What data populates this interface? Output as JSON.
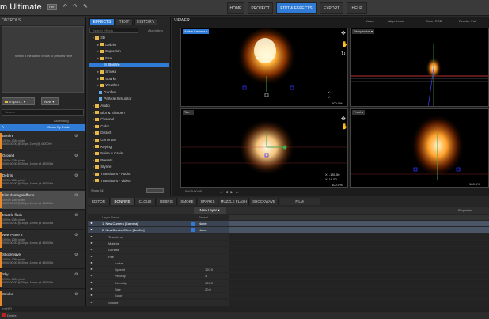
{
  "app": {
    "title": "m Ultimate",
    "file_menu": "File"
  },
  "nav": {
    "items": [
      {
        "label": "HOME"
      },
      {
        "label": "PROJECT"
      },
      {
        "label": "EDIT & EFFECTS"
      },
      {
        "label": "EXPORT"
      },
      {
        "label": "HELP"
      }
    ],
    "active_index": 2
  },
  "controls_panel": {
    "title": "ONTROLS",
    "preview_message": "Select a media file below to preview here"
  },
  "media": {
    "import_label": "Import...",
    "new_label": "New",
    "search_placeholder": "Search",
    "group_label": "A",
    "group_sort": "Group By Folder",
    "sort_label": "Ascending",
    "items": [
      {
        "name": "Bonfire",
        "line1": "1920 x 1080 pixels",
        "line2": "00:00:00:00 @ 30fps, 24ms(@ 48000Hz"
      },
      {
        "name": "Ground",
        "line1": "1920 x 1080 pixels",
        "line2": "00:00:00:00 @ 30fps, Jomes @ 48000Hz"
      },
      {
        "name": "Debris",
        "line1": "1920 x 1080 pixels",
        "line2": "00:00:00:00 @ 30fps, Jomes @ 48000Hz"
      },
      {
        "name": "Film damage/effects",
        "line1": "1920 x 1080 pixels",
        "line2": "00:00:00:00 @ 30fps, Jomes @ 48000Hz"
      },
      {
        "name": "Muzzle flash",
        "line1": "1920 x 1080 pixels",
        "line2": "00:00:00:00 @ 30fps, Jomes @ 48000Hz"
      },
      {
        "name": "New Plane 2",
        "line1": "1920 x 1080 pixels",
        "line2": "00:00:00:00 @ 30fps, Jomes @ 48000Hz"
      },
      {
        "name": "Shockwave",
        "line1": "1920 x 1080 pixels",
        "line2": "00:00:00:00 @ 30fps, Jomes @ 48000Hz"
      },
      {
        "name": "Sky",
        "line1": "1920 x 1080 pixels",
        "line2": "00:00:00:00 @ 30fps, Jomes @ 48000Hz"
      },
      {
        "name": "Smoke",
        "line1": "",
        "line2": ""
      }
    ],
    "selected_index": 3,
    "footer": "Delete"
  },
  "effects_panel": {
    "tabs": [
      "EFFECTS",
      "TEXT",
      "HISTORY"
    ],
    "search_placeholder": "Search Effects",
    "sort_label": "Ascending",
    "tree": [
      {
        "label": "3D",
        "indent": 0,
        "kind": "folder"
      },
      {
        "label": "Debris",
        "indent": 1,
        "kind": "folder"
      },
      {
        "label": "Explosion",
        "indent": 1,
        "kind": "folder"
      },
      {
        "label": "Fire",
        "indent": 1,
        "kind": "folder"
      },
      {
        "label": "Bonfire",
        "indent": 2,
        "kind": "fx",
        "selected": true
      },
      {
        "label": "Smoke",
        "indent": 1,
        "kind": "folder"
      },
      {
        "label": "Sparks",
        "indent": 1,
        "kind": "folder"
      },
      {
        "label": "Weather",
        "indent": 1,
        "kind": "folder"
      },
      {
        "label": "Gunfire",
        "indent": 1,
        "kind": "fx"
      },
      {
        "label": "Particle Simulator",
        "indent": 1,
        "kind": "fx"
      },
      {
        "label": "Audio",
        "indent": 0,
        "kind": "folder"
      },
      {
        "label": "Blur & Sharpen",
        "indent": 0,
        "kind": "folder"
      },
      {
        "label": "Channel",
        "indent": 0,
        "kind": "folder"
      },
      {
        "label": "Color",
        "indent": 0,
        "kind": "folder"
      },
      {
        "label": "Distort",
        "indent": 0,
        "kind": "folder"
      },
      {
        "label": "Generate",
        "indent": 0,
        "kind": "folder"
      },
      {
        "label": "Keying",
        "indent": 0,
        "kind": "folder"
      },
      {
        "label": "Noise & Grain",
        "indent": 0,
        "kind": "folder"
      },
      {
        "label": "Presets",
        "indent": 0,
        "kind": "folder"
      },
      {
        "label": "Stylize",
        "indent": 0,
        "kind": "folder"
      },
      {
        "label": "Transitions - Audio",
        "indent": 0,
        "kind": "folder"
      },
      {
        "label": "Transitions - Video",
        "indent": 0,
        "kind": "folder"
      }
    ],
    "footer": "Show All"
  },
  "viewer": {
    "title": "VIEWER",
    "views_label": "Views",
    "layout_label": "Align: Local",
    "color_label": "Color: RGB",
    "render_label": "Render: Full",
    "viewports": [
      {
        "label": "Active Camera",
        "x": "X:",
        "y": "Y:",
        "xv": "",
        "yv": "",
        "zoom": "100.0%"
      },
      {
        "label": "Perspective",
        "zoom": ""
      },
      {
        "label": "Top",
        "x": "X:",
        "y": "Y:",
        "xv": "-181.50",
        "yv": "18.50",
        "zoom": "100.0%"
      },
      {
        "label": "Front",
        "x": "X:",
        "y": "Y:",
        "xv": "",
        "yv": "",
        "zoom": "100.0%"
      }
    ],
    "timecode": "00:00:00:00"
  },
  "timeline": {
    "tabs": [
      "EDITOR",
      "BONFIRE",
      "CLOUD",
      "DEBRIS",
      "SMOKE",
      "SPARKS",
      "MUZZLE FLASH",
      "SHOCKWAVE",
      "FILM DAMAGE/EFFECTS"
    ],
    "active_tab": 1,
    "new_layer": "New Layer",
    "parent_header": "Parent",
    "name_header": "Layer Name",
    "properties": "Properties",
    "layers": [
      {
        "name": "1. New Camera [Camera]",
        "parent": "None",
        "indent": 0,
        "value": ""
      },
      {
        "name": "2. New Bonfire Effect [Bonfire]",
        "parent": "None",
        "indent": 0,
        "value": ""
      },
      {
        "name": "Transform",
        "indent": 1,
        "value": ""
      },
      {
        "name": "Material",
        "indent": 1,
        "value": ""
      },
      {
        "name": "General",
        "indent": 1,
        "value": ""
      },
      {
        "name": "Fire",
        "indent": 1,
        "value": ""
      },
      {
        "name": "Active",
        "indent": 2,
        "value": ""
      },
      {
        "name": "Spread",
        "indent": 2,
        "value": "120.0"
      },
      {
        "name": "Velocity",
        "indent": 2,
        "value": "3"
      },
      {
        "name": "Intensity",
        "indent": 2,
        "value": "120.0"
      },
      {
        "name": "Size",
        "indent": 2,
        "value": "20.0"
      },
      {
        "name": "Color",
        "indent": 2,
        "value": ""
      },
      {
        "name": "Smoke",
        "indent": 1,
        "value": ""
      }
    ]
  },
  "status": {
    "text": "rm HiFi"
  }
}
